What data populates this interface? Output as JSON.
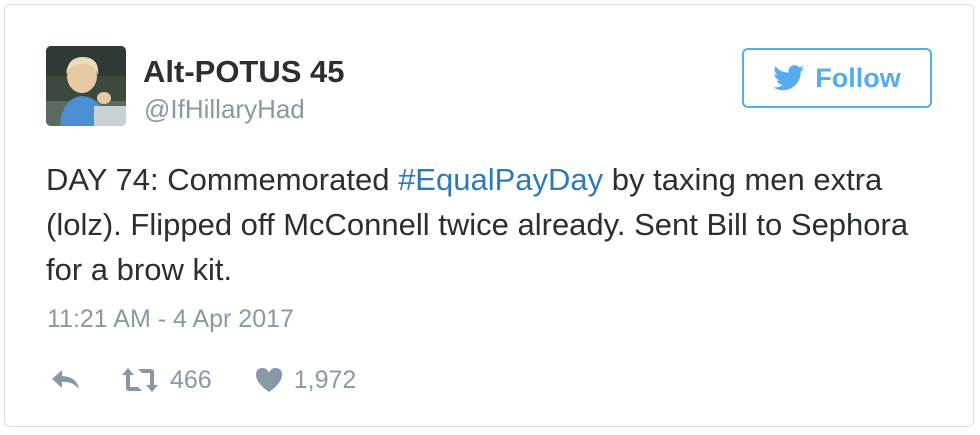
{
  "author": {
    "display_name": "Alt-POTUS 45",
    "handle": "@IfHillaryHad",
    "avatar_icon": "profile-photo"
  },
  "follow_button": {
    "label": "Follow",
    "icon": "twitter-bird-icon",
    "color": "#55acee"
  },
  "tweet": {
    "text_before": "DAY 74: Commemorated ",
    "hashtag": "#EqualPayDay",
    "text_after": " by taxing men extra (lolz). Flipped off McConnell twice already. Sent Bill to Sephora for a brow kit.",
    "timestamp": "11:21 AM - 4 Apr 2017"
  },
  "actions": {
    "reply_icon": "reply-icon",
    "retweet_icon": "retweet-icon",
    "retweet_count": "466",
    "like_icon": "heart-icon",
    "like_count": "1,972"
  },
  "colors": {
    "link": "#2b7bb9",
    "text": "#292f33",
    "muted": "#8899a6"
  }
}
